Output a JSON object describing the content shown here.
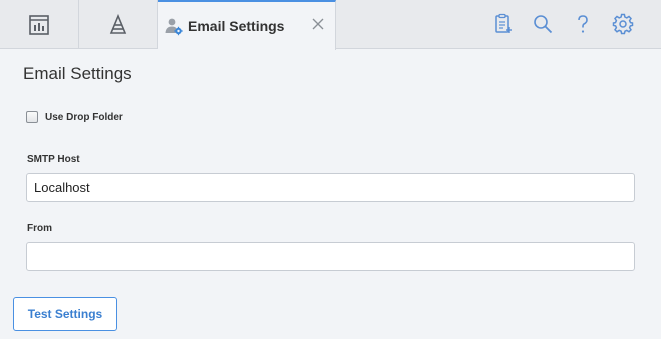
{
  "tabs": {
    "dashboard_icon": "dashboard-icon",
    "pyramid_icon": "pyramid-icon",
    "active": {
      "label": "Email Settings",
      "icon": "user-settings-icon"
    }
  },
  "toolbar": {
    "icons": [
      "document-add-icon",
      "search-icon",
      "help-icon",
      "gear-icon"
    ],
    "accent_color": "#4a90e2",
    "icon_color": "#5b8fd4"
  },
  "page": {
    "title": "Email Settings",
    "use_drop_folder": {
      "label": "Use Drop Folder",
      "checked": false
    },
    "smtp_host": {
      "label": "SMTP Host",
      "value": "Localhost"
    },
    "from": {
      "label": "From",
      "value": ""
    },
    "test_button": "Test Settings"
  }
}
